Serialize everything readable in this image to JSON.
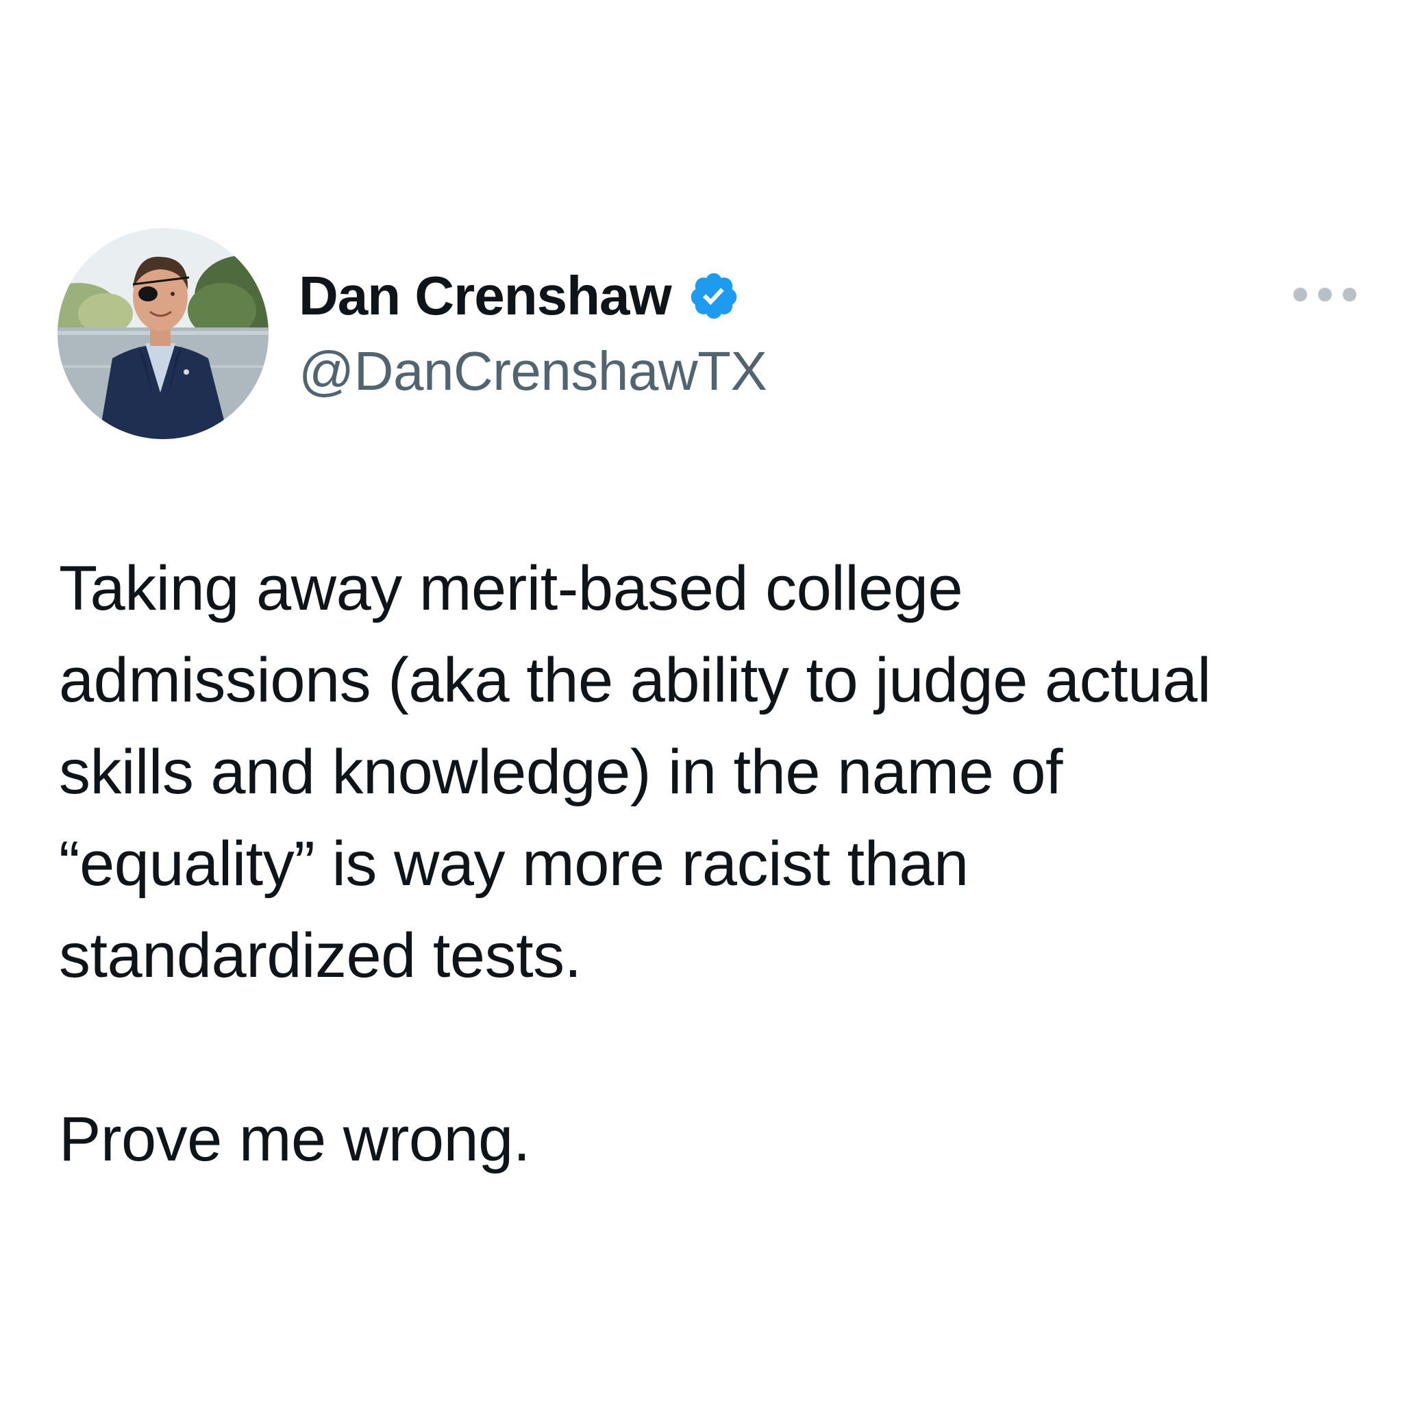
{
  "author": {
    "display_name": "Dan Crenshaw",
    "handle": "@DanCrenshawTX",
    "verified": true,
    "badge_color": "#1d9bf0"
  },
  "tweet": {
    "lines": [
      "Taking away merit-based college",
      "admissions (aka the ability to judge actual",
      "skills and knowledge) in the name of",
      "“equality” is way more racist than",
      "standardized tests."
    ],
    "closing_line": "Prove me wrong."
  },
  "icons": {
    "more": "more-horizontal-icon",
    "verified": "verified-badge-icon"
  },
  "colors": {
    "text_primary": "#0f1419",
    "text_secondary": "#536471",
    "more_dots": "#b9c1c8",
    "background": "#ffffff"
  }
}
